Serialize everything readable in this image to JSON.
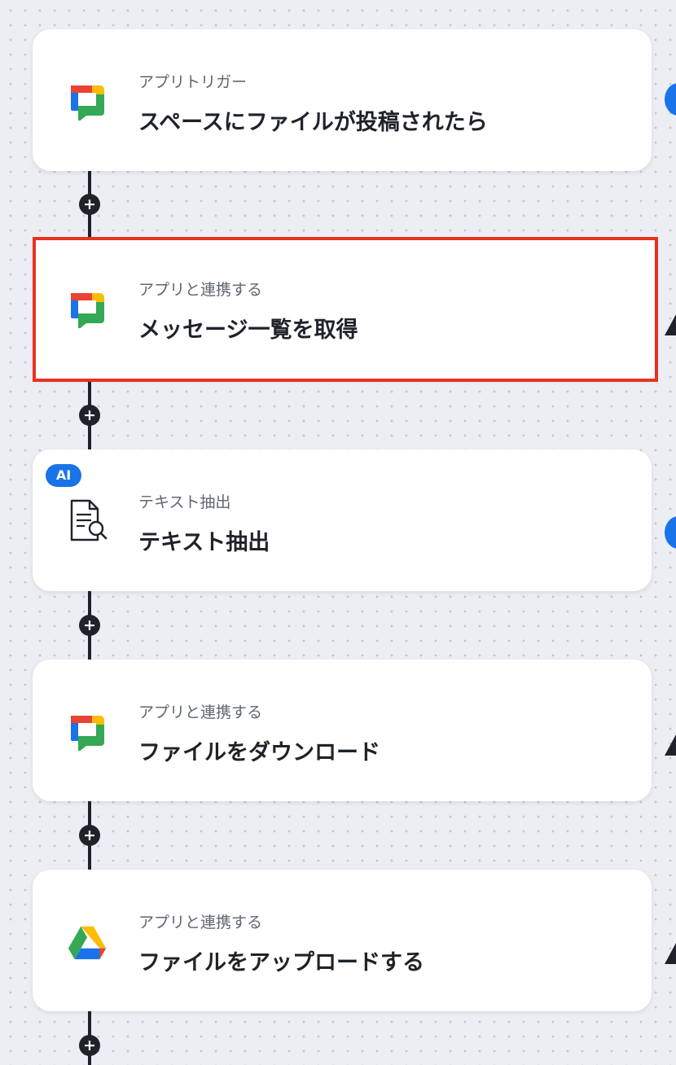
{
  "steps": [
    {
      "type_label": "アプリトリガー",
      "title": "スペースにファイルが投稿されたら",
      "icon": "google-chat-icon",
      "selected": false,
      "badge": ""
    },
    {
      "type_label": "アプリと連携する",
      "title": "メッセージ一覧を取得",
      "icon": "google-chat-icon",
      "selected": true,
      "badge": ""
    },
    {
      "type_label": "テキスト抽出",
      "title": "テキスト抽出",
      "icon": "document-search-icon",
      "selected": false,
      "badge": "AI"
    },
    {
      "type_label": "アプリと連携する",
      "title": "ファイルをダウンロード",
      "icon": "google-chat-icon",
      "selected": false,
      "badge": ""
    },
    {
      "type_label": "アプリと連携する",
      "title": "ファイルをアップロードする",
      "icon": "google-drive-icon",
      "selected": false,
      "badge": ""
    }
  ],
  "add_step_symbol": "+",
  "colors": {
    "google_blue": "#1a73e8",
    "google_red": "#ea4335",
    "google_yellow": "#fbbc04",
    "google_green": "#34a853",
    "selection_outline": "#e8321f",
    "connector": "#1f2329"
  }
}
